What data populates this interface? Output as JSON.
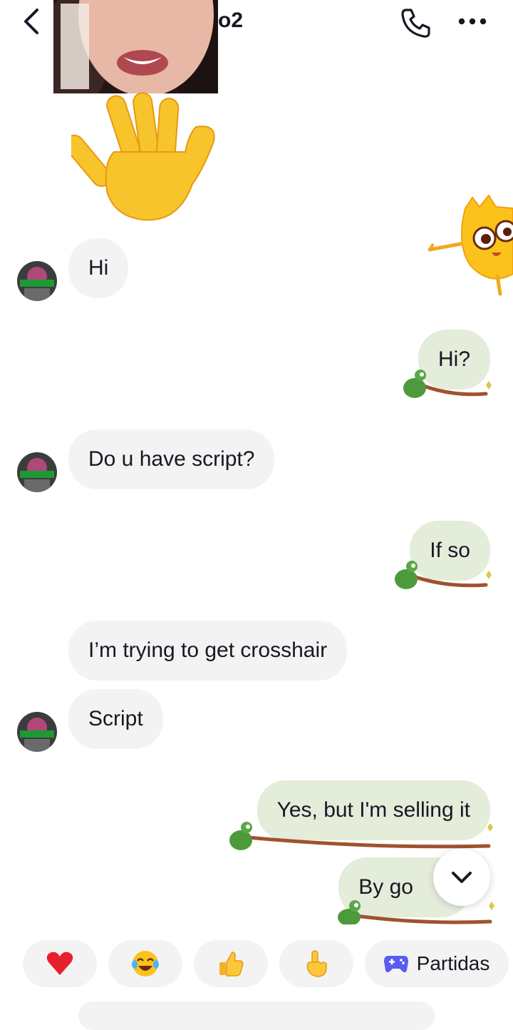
{
  "header": {
    "title_fragment": "o2",
    "back_icon": "chevron-left-icon",
    "call_icon": "phone-icon",
    "more_icon": "more-horizontal-icon"
  },
  "stickers": {
    "wave": "waving-hand-sticker",
    "mascot": "yellow-mascot-sticker"
  },
  "messages": [
    {
      "side": "in",
      "text": "Hi"
    },
    {
      "side": "out",
      "text": "Hi?"
    },
    {
      "side": "in",
      "text": "Do u have script?"
    },
    {
      "side": "out",
      "text": "If so"
    },
    {
      "side": "in",
      "text": "I’m trying to get crosshair"
    },
    {
      "side": "in",
      "text": "Script"
    },
    {
      "side": "out",
      "text": "Yes, but I'm selling it"
    },
    {
      "side": "out",
      "text": "By go"
    }
  ],
  "quick_replies": [
    {
      "icon": "heart-icon",
      "label": ""
    },
    {
      "icon": "laughing-tears-icon",
      "label": ""
    },
    {
      "icon": "thumbs-up-icon",
      "label": ""
    },
    {
      "icon": "pointing-hand-icon",
      "label": ""
    },
    {
      "icon": "gamepad-icon",
      "label": "Partidas"
    }
  ],
  "colors": {
    "incoming_bubble": "#f3f3f3",
    "outgoing_bubble": "#e4ecda",
    "text": "#161823",
    "game_accent": "#5a5cf0"
  }
}
